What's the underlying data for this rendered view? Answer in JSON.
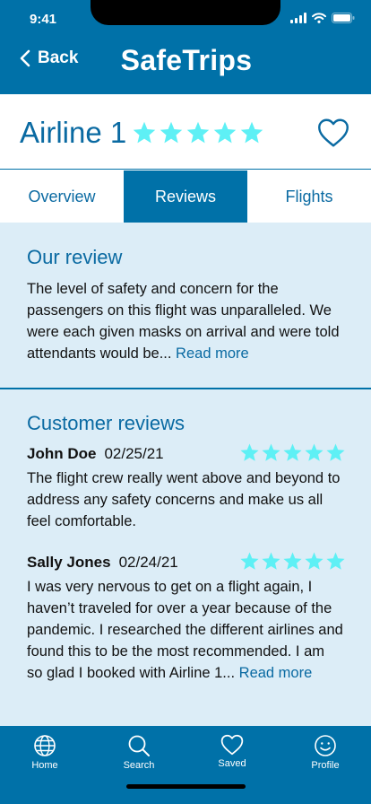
{
  "status_bar": {
    "time": "9:41"
  },
  "header": {
    "back_label": "Back",
    "app_title": "SafeTrips"
  },
  "airline": {
    "name": "Airline 1",
    "rating": 5,
    "rating_max": 5
  },
  "tabs": [
    {
      "label": "Overview",
      "active": false
    },
    {
      "label": "Reviews",
      "active": true
    },
    {
      "label": "Flights",
      "active": false
    }
  ],
  "our_review": {
    "title": "Our review",
    "text": "The level of safety and concern for the passengers on this flight was unparalleled. We were each given masks on arrival and were told attendants would be...",
    "read_more": "Read more"
  },
  "customer_reviews": {
    "title": "Customer reviews",
    "items": [
      {
        "name": "John Doe",
        "date": "02/25/21",
        "rating": 5,
        "text": "The flight crew really went above and beyond to address any safety concerns and make us all feel comfortable."
      },
      {
        "name": "Sally Jones",
        "date": "02/24/21",
        "rating": 5,
        "text": "I was very nervous to get on a flight again, I haven’t traveled for over a year because of the pandemic. I researched the different airlines and found this to be the most recommended. I am so glad I booked with Airline 1...",
        "read_more": "Read more"
      }
    ]
  },
  "tabbar": [
    {
      "label": "Home",
      "icon": "globe-icon"
    },
    {
      "label": "Search",
      "icon": "search-icon"
    },
    {
      "label": "Saved",
      "icon": "heart-icon"
    },
    {
      "label": "Profile",
      "icon": "smiley-icon"
    }
  ],
  "colors": {
    "primary": "#0071a8",
    "accent_text": "#0a6aa2",
    "star": "#5ef0f5",
    "content_bg": "#dcedf7"
  }
}
